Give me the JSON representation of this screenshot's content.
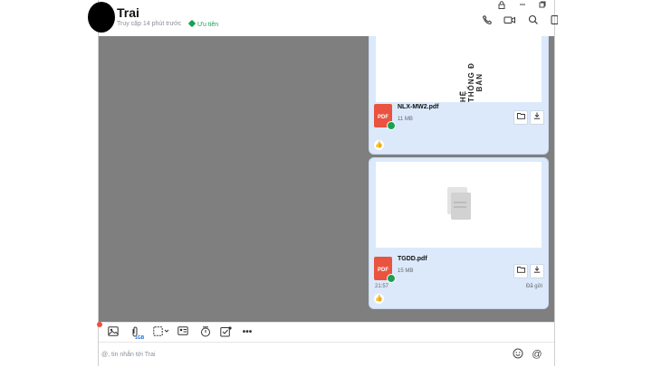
{
  "header": {
    "name": "Trai",
    "status": "Truy cập 14 phút trước",
    "tag": "Ưu tiên",
    "icons": [
      "call-icon",
      "video-icon",
      "search-icon",
      "sidebar-icon",
      "lock-icon",
      "window-icon"
    ]
  },
  "messages": [
    {
      "preview_text": [
        "BẢN",
        "HỆ THỐNG Đ"
      ],
      "file_name": "NLX-MW2.pdf",
      "file_size": "11 MB",
      "file_type": "PDF"
    },
    {
      "file_name": "TGDD.pdf",
      "file_size": "15 MB",
      "file_type": "PDF",
      "time": "21:57",
      "status": "Đã gửi"
    }
  ],
  "toolbar": {
    "file_badge": "1GB",
    "more": "•••"
  },
  "input": {
    "placeholder": "@, tin nhắn tới Trai"
  }
}
